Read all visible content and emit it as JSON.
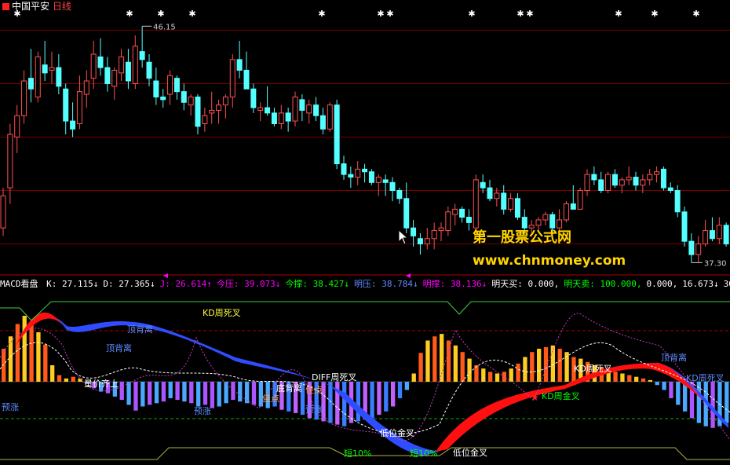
{
  "header": {
    "title": "中国平安",
    "period": "日线",
    "title_color": "#ffffff",
    "period_color": "#ff4040"
  },
  "watermark": {
    "line1": "第一股票公式网",
    "line2": "www.chnmoney.com",
    "color": "#ffd400"
  },
  "price_panel": {
    "max_label": "46.15",
    "min_label": "37.30",
    "up_color": "#ff5050",
    "down_color": "#54ffff",
    "grid_color": "#7a0000"
  },
  "indicator_header": {
    "name": "MACD看盘",
    "items": [
      {
        "label": "K:",
        "value": "27.115↓",
        "color": "#ffffff"
      },
      {
        "label": "D:",
        "value": "27.365↓",
        "color": "#ffffff"
      },
      {
        "label": "J:",
        "value": "26.614↑",
        "color": "#ff00ff"
      },
      {
        "label": "今压:",
        "value": "39.073↓",
        "color": "#ff00ff"
      },
      {
        "label": "今撑:",
        "value": "38.427↓",
        "color": "#00ff00"
      },
      {
        "label": "明压:",
        "value": "38.784↓",
        "color": "#5e8bff"
      },
      {
        "label": "明撑:",
        "value": "38.136↓",
        "color": "#ff00ff"
      },
      {
        "label": "明天买:",
        "value": "0.000,",
        "color": "#ffffff"
      },
      {
        "label": "明天卖:",
        "value": "100.000,",
        "color": "#00ff00"
      },
      {
        "label": "",
        "value": "0.000,",
        "color": "#ffffff"
      },
      {
        "label": "",
        "value": "16.673↓",
        "color": "#ffffff"
      },
      {
        "label": "",
        "value": "30.2",
        "color": "#ffffff"
      }
    ]
  },
  "annotations": [
    {
      "text": "KD周死叉",
      "color": "#ffff40"
    },
    {
      "text": "顶背离",
      "color": "#5e8bff"
    },
    {
      "text": "顶背离",
      "color": "#5e8bff"
    },
    {
      "text": "量价齐上",
      "color": "#ffffff"
    },
    {
      "text": "预涨",
      "color": "#5e8bff"
    },
    {
      "text": "预涨",
      "color": "#5e8bff"
    },
    {
      "text": "佳点",
      "color": "#ffa040"
    },
    {
      "text": "底背离",
      "color": "#ffffff"
    },
    {
      "text": "佳点",
      "color": "#ffa040"
    },
    {
      "text": "预涨",
      "color": "#5e8bff"
    },
    {
      "text": "DIFF周死叉",
      "color": "#ffffff"
    },
    {
      "text": "低位金叉",
      "color": "#ffffff"
    },
    {
      "text": "短10%",
      "color": "#00ff00"
    },
    {
      "text": "短10%",
      "color": "#00ff00"
    },
    {
      "text": "低位金叉",
      "color": "#ffffff"
    },
    {
      "text": "KD周死叉",
      "color": "#ffffff"
    },
    {
      "text": "KD周金叉",
      "color": "#00ff00"
    },
    {
      "text": "顶背离",
      "color": "#5e8bff"
    },
    {
      "text": "KD周死叉",
      "color": "#5e8bff"
    }
  ],
  "chart_data": {
    "type": "candlestick",
    "title": "中国平安 日线",
    "y_max_marked": 46.15,
    "y_min_marked": 37.3,
    "candles": [
      [
        38.6,
        40.1,
        38.3,
        39.8
      ],
      [
        40.1,
        42.5,
        39.5,
        42.1
      ],
      [
        42.0,
        43.2,
        41.4,
        42.8
      ],
      [
        42.8,
        44.5,
        42.5,
        44.1
      ],
      [
        44.2,
        45.3,
        43.3,
        43.8
      ],
      [
        43.5,
        45.2,
        43.3,
        45.0
      ],
      [
        44.7,
        45.6,
        44.1,
        44.4
      ],
      [
        44.5,
        45.2,
        44.0,
        44.6
      ],
      [
        44.6,
        45.1,
        43.6,
        43.9
      ],
      [
        43.8,
        44.0,
        42.1,
        42.6
      ],
      [
        42.6,
        43.3,
        42.0,
        42.3
      ],
      [
        42.5,
        44.3,
        42.3,
        43.7
      ],
      [
        43.6,
        44.5,
        43.1,
        44.1
      ],
      [
        44.2,
        45.6,
        43.8,
        45.1
      ],
      [
        45.0,
        45.7,
        44.3,
        44.6
      ],
      [
        44.6,
        45.0,
        43.7,
        44.0
      ],
      [
        43.9,
        44.6,
        43.4,
        44.5
      ],
      [
        44.4,
        45.3,
        44.1,
        45.0
      ],
      [
        44.8,
        45.3,
        43.8,
        44.1
      ],
      [
        44.0,
        45.8,
        43.8,
        45.4
      ],
      [
        45.2,
        46.15,
        44.6,
        44.9
      ],
      [
        44.8,
        45.1,
        43.9,
        44.2
      ],
      [
        44.1,
        44.6,
        43.2,
        43.5
      ],
      [
        43.5,
        43.8,
        43.1,
        43.4
      ],
      [
        43.6,
        44.5,
        43.2,
        44.3
      ],
      [
        44.2,
        44.3,
        43.4,
        43.7
      ],
      [
        43.7,
        44.0,
        43.0,
        43.3
      ],
      [
        43.2,
        43.6,
        42.8,
        43.5
      ],
      [
        43.5,
        43.6,
        42.1,
        42.4
      ],
      [
        42.5,
        43.1,
        42.2,
        42.8
      ],
      [
        42.9,
        43.7,
        42.5,
        43.0
      ],
      [
        43.0,
        43.4,
        42.5,
        43.2
      ],
      [
        43.2,
        43.6,
        42.7,
        43.5
      ],
      [
        43.5,
        45.1,
        43.1,
        44.9
      ],
      [
        44.9,
        45.6,
        44.2,
        44.5
      ],
      [
        44.5,
        45.2,
        43.8,
        43.8
      ],
      [
        43.8,
        44.0,
        42.9,
        43.1
      ],
      [
        43.0,
        43.3,
        42.6,
        43.1
      ],
      [
        43.1,
        43.9,
        42.8,
        42.9
      ],
      [
        42.9,
        43.1,
        42.4,
        42.5
      ],
      [
        42.5,
        43.2,
        42.3,
        42.9
      ],
      [
        42.9,
        43.1,
        42.2,
        42.6
      ],
      [
        42.6,
        43.7,
        42.4,
        43.5
      ],
      [
        43.4,
        43.6,
        42.6,
        43.0
      ],
      [
        42.9,
        43.4,
        42.5,
        43.2
      ],
      [
        43.2,
        43.5,
        42.6,
        42.8
      ],
      [
        42.8,
        43.1,
        42.1,
        42.3
      ],
      [
        42.3,
        43.3,
        42.2,
        43.2
      ],
      [
        43.2,
        43.4,
        40.8,
        41.0
      ],
      [
        41.0,
        41.3,
        40.4,
        40.6
      ],
      [
        40.6,
        40.9,
        40.1,
        40.5
      ],
      [
        40.5,
        41.1,
        40.2,
        40.8
      ],
      [
        40.8,
        41.0,
        40.3,
        40.7
      ],
      [
        40.7,
        40.8,
        40.2,
        40.3
      ],
      [
        40.3,
        40.6,
        39.8,
        40.5
      ],
      [
        40.4,
        40.6,
        39.8,
        40.3
      ],
      [
        40.3,
        40.5,
        39.6,
        40.0
      ],
      [
        40.0,
        40.1,
        39.5,
        39.7
      ],
      [
        39.7,
        40.3,
        38.4,
        38.6
      ],
      [
        38.6,
        38.9,
        37.9,
        38.3
      ],
      [
        38.2,
        38.4,
        37.6,
        38.0
      ],
      [
        38.0,
        38.6,
        37.8,
        38.2
      ],
      [
        38.2,
        38.8,
        37.8,
        38.5
      ],
      [
        38.5,
        38.8,
        38.1,
        38.6
      ],
      [
        38.5,
        39.4,
        38.3,
        39.2
      ],
      [
        39.1,
        39.5,
        38.7,
        39.3
      ],
      [
        39.3,
        39.4,
        38.8,
        39.0
      ],
      [
        39.0,
        39.3,
        38.5,
        38.8
      ],
      [
        38.6,
        40.6,
        38.4,
        40.4
      ],
      [
        40.3,
        40.6,
        39.9,
        40.1
      ],
      [
        40.1,
        40.4,
        39.6,
        39.7
      ],
      [
        39.7,
        40.1,
        39.4,
        39.9
      ],
      [
        39.9,
        40.2,
        39.1,
        39.3
      ],
      [
        39.3,
        39.9,
        39.2,
        39.7
      ],
      [
        39.7,
        39.9,
        38.9,
        39.0
      ],
      [
        39.0,
        39.3,
        38.4,
        38.6
      ],
      [
        38.6,
        38.9,
        38.3,
        38.7
      ],
      [
        38.7,
        39.0,
        38.5,
        38.9
      ],
      [
        38.9,
        39.2,
        38.7,
        39.1
      ],
      [
        39.1,
        39.2,
        38.2,
        38.6
      ],
      [
        38.6,
        39.3,
        38.5,
        38.9
      ],
      [
        38.9,
        39.6,
        38.8,
        39.5
      ],
      [
        39.5,
        40.2,
        39.3,
        39.3
      ],
      [
        39.3,
        40.1,
        39.3,
        40.0
      ],
      [
        40.0,
        40.8,
        39.8,
        40.6
      ],
      [
        40.6,
        40.9,
        40.2,
        40.4
      ],
      [
        40.4,
        40.7,
        39.9,
        40.0
      ],
      [
        40.0,
        40.7,
        39.9,
        40.6
      ],
      [
        40.6,
        40.8,
        40.1,
        40.2
      ],
      [
        40.2,
        40.5,
        39.9,
        40.4
      ],
      [
        40.4,
        40.9,
        40.2,
        40.5
      ],
      [
        40.5,
        40.7,
        40.0,
        40.2
      ],
      [
        40.2,
        40.6,
        39.9,
        40.4
      ],
      [
        40.4,
        40.8,
        40.2,
        40.6
      ],
      [
        40.6,
        40.9,
        40.3,
        40.7
      ],
      [
        40.8,
        40.9,
        40.0,
        40.1
      ],
      [
        40.1,
        40.3,
        39.9,
        40.0
      ],
      [
        40.0,
        40.2,
        39.0,
        39.2
      ],
      [
        39.2,
        39.4,
        37.9,
        38.1
      ],
      [
        38.1,
        38.4,
        37.3,
        37.6
      ],
      [
        37.6,
        38.3,
        37.3,
        38.0
      ],
      [
        38.0,
        38.9,
        37.9,
        38.5
      ],
      [
        38.5,
        39.0,
        38.1,
        38.2
      ],
      [
        38.2,
        39.0,
        38.0,
        38.7
      ],
      [
        38.7,
        38.8,
        37.9,
        38.0
      ]
    ]
  }
}
